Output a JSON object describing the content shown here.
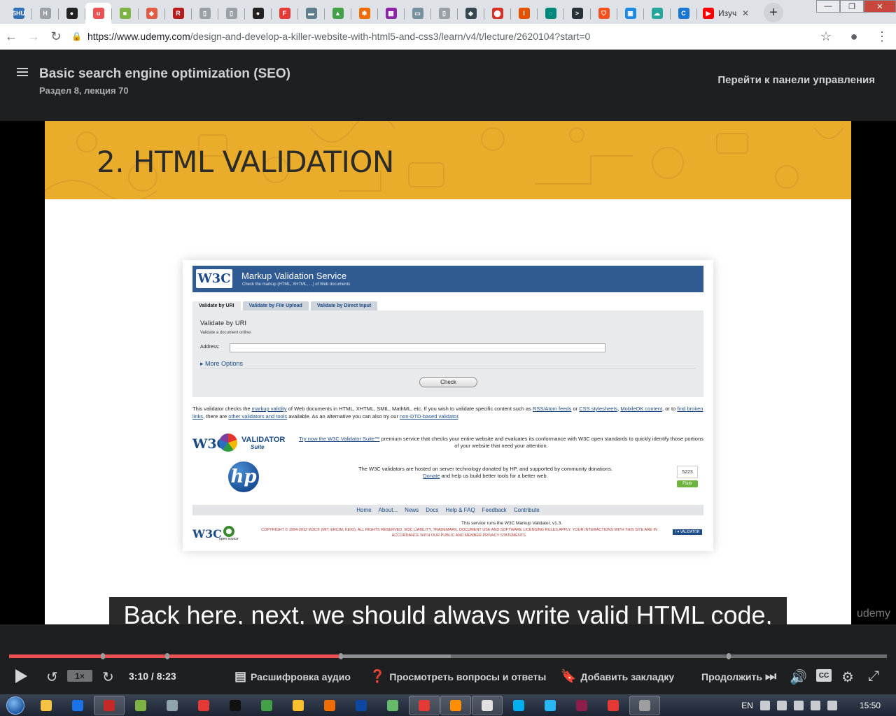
{
  "browser": {
    "tabs": [
      {
        "icon": "shu-blog-icon",
        "color": "#2e6fb5",
        "glyph": "SHU"
      },
      {
        "icon": "h-icon",
        "color": "#9aa0a6",
        "glyph": "H"
      },
      {
        "icon": "github-icon",
        "color": "#222222",
        "glyph": "●"
      },
      {
        "icon": "udemy-icon",
        "color": "#ec5252",
        "glyph": "u",
        "active": true
      },
      {
        "icon": "green-box-icon",
        "color": "#7cb342",
        "glyph": "■"
      },
      {
        "icon": "git-icon",
        "color": "#e05d44",
        "glyph": "◆"
      },
      {
        "icon": "r-icon",
        "color": "#b71c1c",
        "glyph": "R"
      },
      {
        "icon": "doc-icon",
        "color": "#9aa0a6",
        "glyph": "▯"
      },
      {
        "icon": "doc-icon",
        "color": "#9aa0a6",
        "glyph": "▯"
      },
      {
        "icon": "github-icon",
        "color": "#222222",
        "glyph": "●"
      },
      {
        "icon": "f-icon",
        "color": "#e53935",
        "glyph": "F"
      },
      {
        "icon": "window-icon",
        "color": "#607d8b",
        "glyph": "▬"
      },
      {
        "icon": "chart-icon",
        "color": "#43a047",
        "glyph": "▲"
      },
      {
        "icon": "star-icon",
        "color": "#ef6c00",
        "glyph": "✱"
      },
      {
        "icon": "grid-icon",
        "color": "#8e24aa",
        "glyph": "▦"
      },
      {
        "icon": "folder-icon",
        "color": "#78909c",
        "glyph": "▭"
      },
      {
        "icon": "doc-icon",
        "color": "#9aa0a6",
        "glyph": "▯"
      },
      {
        "icon": "code-icon",
        "color": "#37474f",
        "glyph": "◈"
      },
      {
        "icon": "maps-icon",
        "color": "#d93025",
        "glyph": "⬤"
      },
      {
        "icon": "pin-icon",
        "color": "#e65100",
        "glyph": "I"
      },
      {
        "icon": "spin-icon",
        "color": "#00897b",
        "glyph": "◌"
      },
      {
        "icon": "terminal-icon",
        "color": "#263238",
        "glyph": ">"
      },
      {
        "icon": "shield-icon",
        "color": "#f4511e",
        "glyph": "⛉"
      },
      {
        "icon": "photo-icon",
        "color": "#1e88e5",
        "glyph": "▣"
      },
      {
        "icon": "cloud-icon",
        "color": "#26a69a",
        "glyph": "☁"
      },
      {
        "icon": "css-icon",
        "color": "#1976d2",
        "glyph": "C"
      }
    ],
    "last_tab": {
      "label": "Изуч",
      "icon": "youtube-icon",
      "color": "#ff0000"
    },
    "url_host": "https://www.udemy.com",
    "url_path": "/design-and-develop-a-killer-website-with-html5-and-css3/learn/v4/t/lecture/2620104?start=0"
  },
  "header": {
    "title": "Basic search engine optimization (SEO)",
    "subtitle": "Раздел 8, лекция 70",
    "dashboard_link": "Перейти к панели управления"
  },
  "slide": {
    "title": "2. HTML VALIDATION",
    "banner_color": "#e9ac2b"
  },
  "w3c": {
    "logo": "W3C",
    "service_title": "Markup Validation Service",
    "service_sub": "Check the markup (HTML, XHTML, ...) of Web documents",
    "tabs": [
      "Validate by URI",
      "Validate by File Upload",
      "Validate by Direct Input"
    ],
    "form_title": "Validate by URI",
    "form_sub": "Validate a document online:",
    "address_label": "Address:",
    "more_options": "More Options",
    "check_button": "Check",
    "desc_parts": [
      {
        "t": "This validator checks the ",
        "l": false
      },
      {
        "t": "markup validity",
        "l": true
      },
      {
        "t": " of Web documents in HTML, XHTML, SMIL, MathML, etc. If you wish to validate specific content such as ",
        "l": false
      },
      {
        "t": "RSS/Atom feeds",
        "l": true
      },
      {
        "t": " or ",
        "l": false
      },
      {
        "t": "CSS stylesheets",
        "l": true
      },
      {
        "t": ", ",
        "l": false
      },
      {
        "t": "MobileOK content",
        "l": true
      },
      {
        "t": ", or to ",
        "l": false
      },
      {
        "t": "find broken links",
        "l": true
      },
      {
        "t": ", there are ",
        "l": false
      },
      {
        "t": "other validators and tools",
        "l": true
      },
      {
        "t": " available. As an alternative you can also try our ",
        "l": false
      },
      {
        "t": "non-DTD-based validator",
        "l": true
      },
      {
        "t": ".",
        "l": false
      }
    ],
    "suite_logo_a": "W3C",
    "suite_logo_c": "VALIDATOR",
    "suite_logo_d": "Suite",
    "suite_link": "Try now the W3C Validator Suite™",
    "suite_text": " premium service that checks your entire website and evaluates its conformance with W3C open standards to quickly identify those portions of your website that need your attention.",
    "hp_logo": "hp",
    "hp_text1": "The W3C validators are hosted on server technology donated by HP, and supported by community donations.",
    "hp_donate": "Donate",
    "hp_text2": " and help us build better tools for a better web.",
    "flattr_count": "5223",
    "flattr_label": "Flattr",
    "footer_links": [
      "Home",
      "About...",
      "News",
      "Docs",
      "Help & FAQ",
      "Feedback",
      "Contribute"
    ],
    "copy1": "This service runs the W3C Markup Validator, v1.3.",
    "copy2": "COPYRIGHT © 1994-2012 W3C® (MIT, ERCIM, KEIO), ALL RIGHTS RESERVED. W3C LIABILITY, TRADEMARK, DOCUMENT USE AND SOFTWARE LICENSING RULES APPLY. YOUR INTERACTIONS WITH THIS SITE ARE IN ACCORDANCE WITH OUR PUBLIC AND MEMBER PRIVACY STATEMENTS.",
    "opensource": "open source",
    "badge": "I ♥ VALIDATOR"
  },
  "video": {
    "caption": "Back here, next, we should always write valid HTML code,",
    "watermark": "udemy"
  },
  "player": {
    "speed": "1×",
    "time": "3:10 / 8:23",
    "progress_fraction": 0.378,
    "buffered_fraction": 0.503,
    "chapter_marks": [
      0.107,
      0.18,
      0.378,
      0.82
    ],
    "transcript": "Расшифровка аудио",
    "qa": "Просмотреть вопросы и ответы",
    "bookmark": "Добавить закладку",
    "continue": "Продолжить",
    "cc": "CC"
  },
  "taskbar": {
    "items": [
      {
        "icon": "explorer-icon",
        "color": "#f5c242",
        "open": false
      },
      {
        "icon": "teamviewer-icon",
        "color": "#1a73e8",
        "open": false
      },
      {
        "icon": "save-icon",
        "color": "#c62828",
        "open": true
      },
      {
        "icon": "android-icon",
        "color": "#7cb342",
        "open": false
      },
      {
        "icon": "box-icon",
        "color": "#90a4ae",
        "open": false
      },
      {
        "icon": "oo-icon",
        "color": "#e53935",
        "open": false
      },
      {
        "icon": "intellij-icon",
        "color": "#111111",
        "open": false
      },
      {
        "icon": "globe-icon",
        "color": "#43a047",
        "open": false
      },
      {
        "icon": "chrome-alt-icon",
        "color": "#fbc02d",
        "open": false
      },
      {
        "icon": "firefox-icon",
        "color": "#ef6c00",
        "open": false
      },
      {
        "icon": "photoshop-icon",
        "color": "#0d47a1",
        "open": false
      },
      {
        "icon": "atom-icon",
        "color": "#66bb6a",
        "open": false
      },
      {
        "icon": "chrome-icon",
        "color": "#e53935",
        "open": true
      },
      {
        "icon": "sublime-icon",
        "color": "#ff8f00",
        "open": true
      },
      {
        "icon": "tool-icon",
        "color": "#e0e0e0",
        "open": true
      },
      {
        "icon": "skype-icon",
        "color": "#00aff0",
        "open": false
      },
      {
        "icon": "window-icon",
        "color": "#29b6f6",
        "open": false
      },
      {
        "icon": "winrar-icon",
        "color": "#8d1d4a",
        "open": false
      },
      {
        "icon": "chrome-icon",
        "color": "#e53935",
        "open": false
      },
      {
        "icon": "app-icon",
        "color": "#9e9e9e",
        "open": true
      }
    ],
    "lang": "EN",
    "clock": "15:50"
  }
}
